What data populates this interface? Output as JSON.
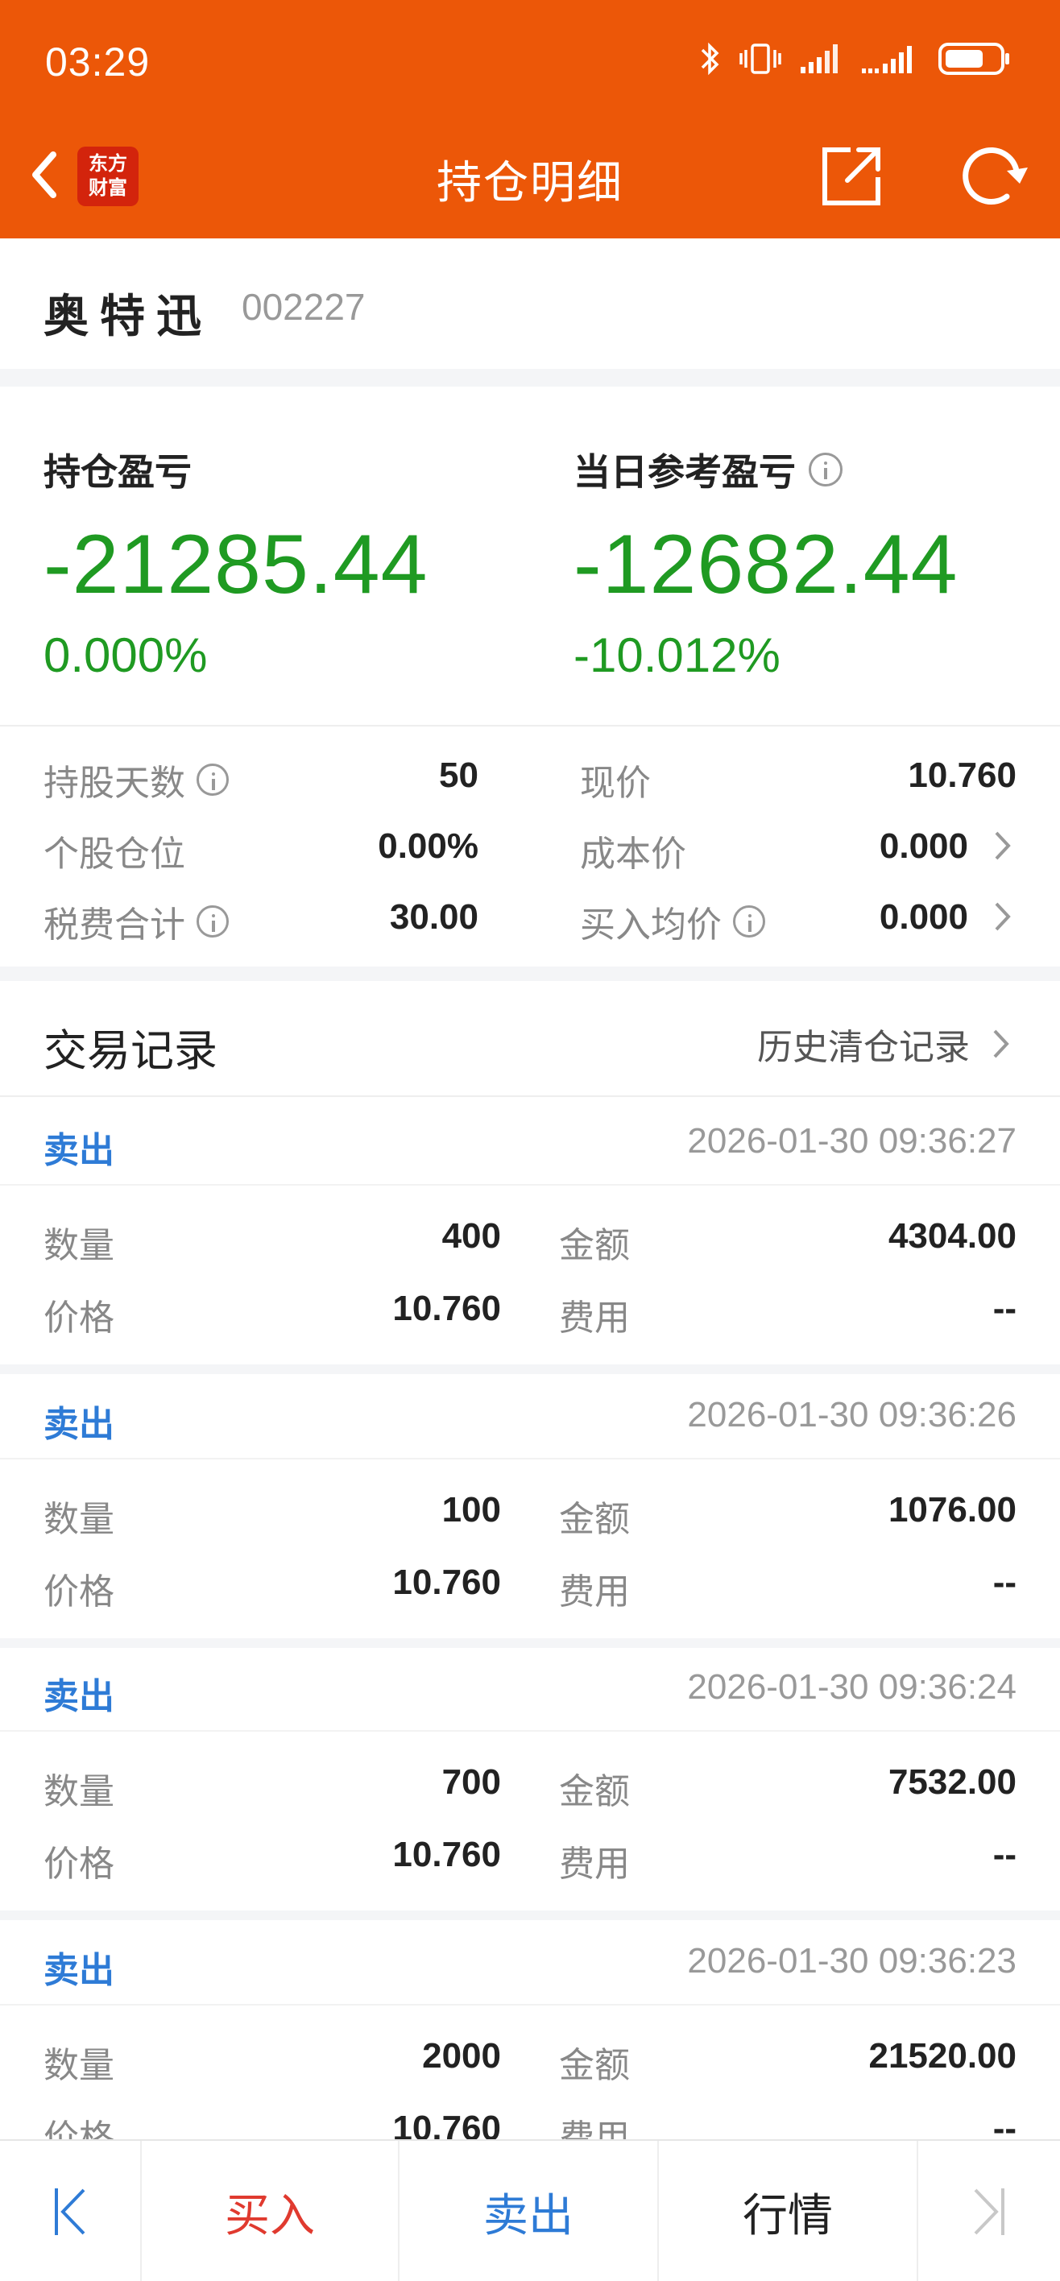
{
  "status_bar": {
    "time": "03:29"
  },
  "header": {
    "title": "持仓明细",
    "logo_text_line1": "东方",
    "logo_text_line2": "财富"
  },
  "stock": {
    "name": "奥特迅",
    "code": "002227"
  },
  "pl": {
    "position_label": "持仓盈亏",
    "position_value": "-21285.44",
    "position_pct": "0.000%",
    "daily_label": "当日参考盈亏",
    "daily_value": "-12682.44",
    "daily_pct": "-10.012%"
  },
  "stats": {
    "hold_days_label": "持股天数",
    "hold_days": "50",
    "current_price_label": "现价",
    "current_price": "10.760",
    "position_ratio_label": "个股仓位",
    "position_ratio": "0.00%",
    "cost_price_label": "成本价",
    "cost_price": "0.000",
    "tax_fee_label": "税费合计",
    "tax_fee": "30.00",
    "avg_buy_label": "买入均价",
    "avg_buy": "0.000"
  },
  "trades": {
    "title": "交易记录",
    "history_link": "历史清仓记录",
    "labels": {
      "qty": "数量",
      "amount": "金额",
      "price": "价格",
      "fee": "费用"
    },
    "items": [
      {
        "type": "卖出",
        "time": "2026-01-30 09:36:27",
        "qty": "400",
        "amount": "4304.00",
        "price": "10.760",
        "fee": "--"
      },
      {
        "type": "卖出",
        "time": "2026-01-30 09:36:26",
        "qty": "100",
        "amount": "1076.00",
        "price": "10.760",
        "fee": "--"
      },
      {
        "type": "卖出",
        "time": "2026-01-30 09:36:24",
        "qty": "700",
        "amount": "7532.00",
        "price": "10.760",
        "fee": "--"
      },
      {
        "type": "卖出",
        "time": "2026-01-30 09:36:23",
        "qty": "2000",
        "amount": "21520.00",
        "price": "10.760",
        "fee": "--"
      }
    ]
  },
  "bottom_bar": {
    "buy": "买入",
    "sell": "卖出",
    "quote": "行情"
  },
  "colors": {
    "header_bg": "#ec5708",
    "loss_green": "#1f9a22",
    "sell_blue": "#2e7bd6",
    "buy_red": "#e03a2f"
  }
}
